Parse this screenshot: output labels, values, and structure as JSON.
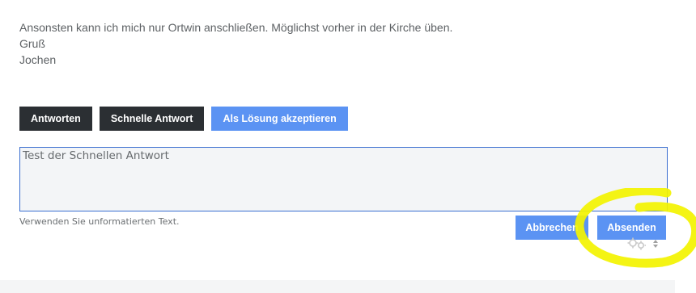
{
  "post": {
    "lines": [
      "Ansonsten kann ich mich nur Ortwin anschließen. Möglichst vorher in der Kirche üben.",
      "Gruß",
      "Jochen"
    ]
  },
  "actions": {
    "reply_label": "Antworten",
    "quick_reply_label": "Schnelle Antwort",
    "accept_solution_label": "Als Lösung akzeptieren"
  },
  "quick_reply": {
    "value": "Test der Schnellen Antwort",
    "hint": "Verwenden Sie unformatierten Text.",
    "cancel_label": "Abbrechen",
    "send_label": "Absenden"
  },
  "icons": {
    "settings": "gear-icon",
    "sort": "up-down-arrow-icon"
  },
  "colors": {
    "dark_button": "#2b2f33",
    "primary_blue": "#5b93f3",
    "highlight_yellow": "#f5f500"
  }
}
